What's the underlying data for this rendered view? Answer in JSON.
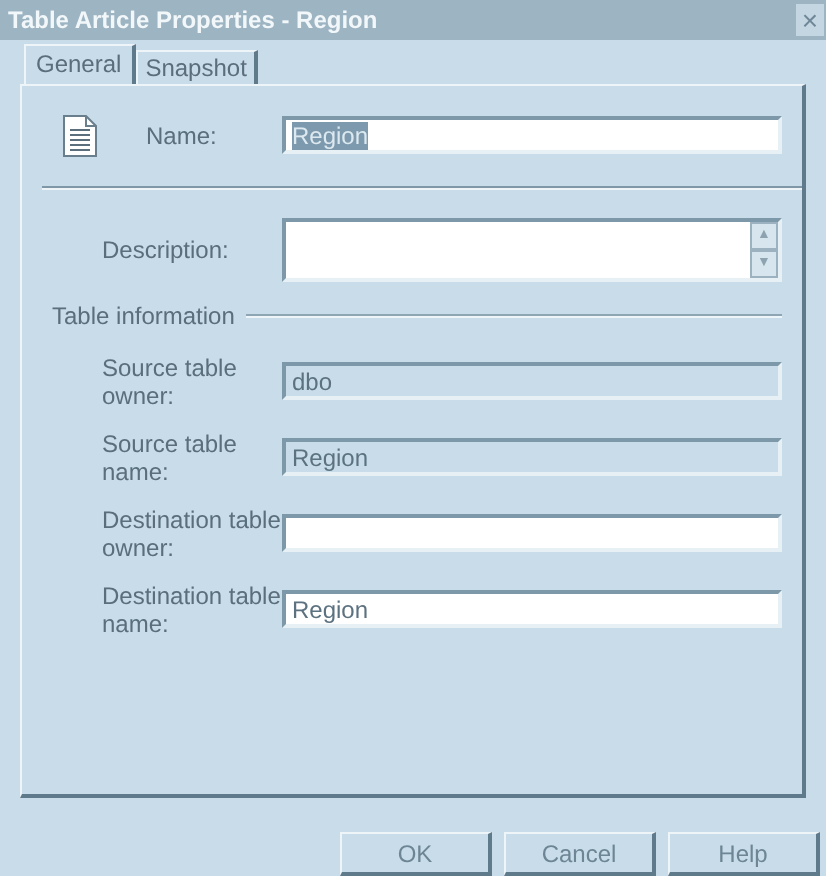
{
  "window": {
    "title": "Table Article Properties - Region",
    "close": "×"
  },
  "tabs": [
    {
      "label": "General",
      "selected": true
    },
    {
      "label": "Snapshot",
      "selected": false
    }
  ],
  "name_field": {
    "label": "Name:",
    "value": "Region",
    "text_selected": true
  },
  "description_field": {
    "label": "Description:",
    "scroll_up": "▲",
    "scroll_down": "▼"
  },
  "group": {
    "title": "Table information"
  },
  "fields": [
    {
      "label": "Source table owner:",
      "value": "dbo",
      "disabled": true
    },
    {
      "label": "Source table name:",
      "value": "Region",
      "disabled": true
    },
    {
      "label": "Destination table owner:",
      "disabled": false
    },
    {
      "label": "Destination table name:",
      "value": "Region",
      "disabled": false
    }
  ],
  "buttons": [
    {
      "label": "OK"
    },
    {
      "label": "Cancel"
    },
    {
      "label": "Help"
    }
  ]
}
